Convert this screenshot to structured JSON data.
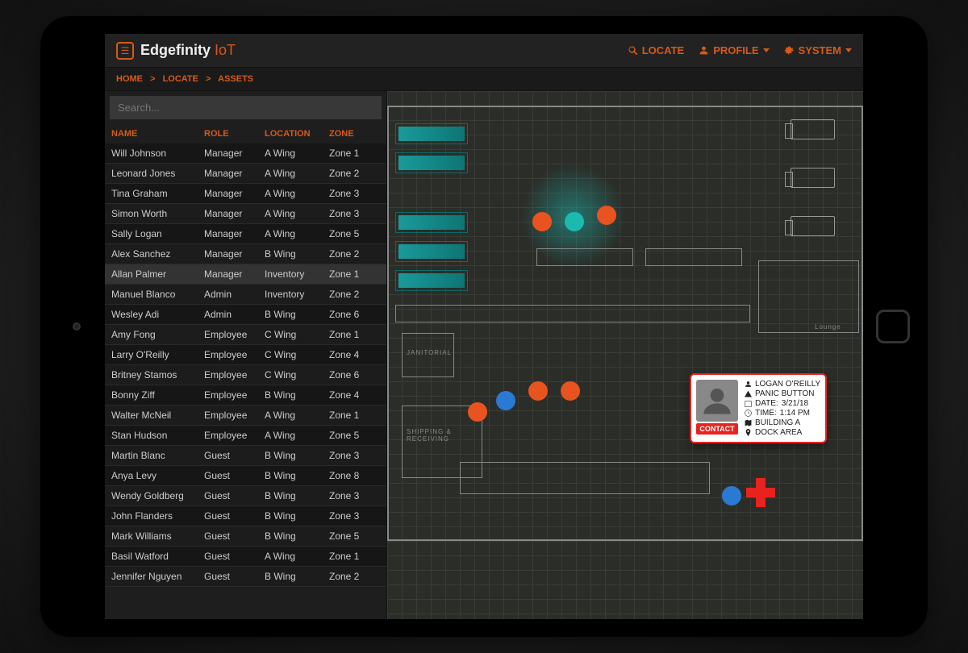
{
  "app": {
    "name": "Edgefinity",
    "suffix": "IoT"
  },
  "nav": {
    "locate": "LOCATE",
    "profile": "PROFILE",
    "system": "SYSTEM"
  },
  "breadcrumb": {
    "home": "HOME",
    "locate": "LOCATE",
    "assets": "ASSETS",
    "sep": ">"
  },
  "search": {
    "placeholder": "Search..."
  },
  "columns": {
    "name": "NAME",
    "role": "ROLE",
    "location": "LOCATION",
    "zone": "ZONE"
  },
  "people": [
    {
      "name": "Will Johnson",
      "role": "Manager",
      "location": "A Wing",
      "zone": "Zone 1"
    },
    {
      "name": "Leonard Jones",
      "role": "Manager",
      "location": "A Wing",
      "zone": "Zone 2"
    },
    {
      "name": "Tina Graham",
      "role": "Manager",
      "location": "A Wing",
      "zone": "Zone 3"
    },
    {
      "name": "Simon Worth",
      "role": "Manager",
      "location": "A Wing",
      "zone": "Zone 3"
    },
    {
      "name": "Sally Logan",
      "role": "Manager",
      "location": "A Wing",
      "zone": "Zone 5"
    },
    {
      "name": "Alex Sanchez",
      "role": "Manager",
      "location": "B Wing",
      "zone": "Zone 2"
    },
    {
      "name": "Allan Palmer",
      "role": "Manager",
      "location": "Inventory",
      "zone": "Zone 1",
      "selected": true
    },
    {
      "name": "Manuel Blanco",
      "role": "Admin",
      "location": "Inventory",
      "zone": "Zone 2"
    },
    {
      "name": "Wesley Adi",
      "role": "Admin",
      "location": "B Wing",
      "zone": "Zone 6"
    },
    {
      "name": "Amy Fong",
      "role": "Employee",
      "location": "C Wing",
      "zone": "Zone 1"
    },
    {
      "name": "Larry O'Reilly",
      "role": "Employee",
      "location": "C Wing",
      "zone": "Zone 4"
    },
    {
      "name": "Britney Stamos",
      "role": "Employee",
      "location": "C Wing",
      "zone": "Zone 6"
    },
    {
      "name": "Bonny Ziff",
      "role": "Employee",
      "location": "B Wing",
      "zone": "Zone 4"
    },
    {
      "name": "Walter McNeil",
      "role": "Employee",
      "location": "A Wing",
      "zone": "Zone 1"
    },
    {
      "name": "Stan Hudson",
      "role": "Employee",
      "location": "A Wing",
      "zone": "Zone 5"
    },
    {
      "name": "Martin Blanc",
      "role": "Guest",
      "location": "B Wing",
      "zone": "Zone 3"
    },
    {
      "name": "Anya Levy",
      "role": "Guest",
      "location": "B Wing",
      "zone": "Zone 8"
    },
    {
      "name": "Wendy Goldberg",
      "role": "Guest",
      "location": "B Wing",
      "zone": "Zone 3"
    },
    {
      "name": "John Flanders",
      "role": "Guest",
      "location": "B Wing",
      "zone": "Zone 3"
    },
    {
      "name": "Mark Williams",
      "role": "Guest",
      "location": "B Wing",
      "zone": "Zone 5"
    },
    {
      "name": "Basil Watford",
      "role": "Guest",
      "location": "A Wing",
      "zone": "Zone 1"
    },
    {
      "name": "Jennifer Nguyen",
      "role": "Guest",
      "location": "B Wing",
      "zone": "Zone 2"
    }
  ],
  "map_labels": {
    "janitorial": "JANITORIAL",
    "shipping": "SHIPPING & RECEIVING",
    "lounge": "Lounge"
  },
  "popup": {
    "name": "LOGAN O'REILLY",
    "alert": "PANIC BUTTON",
    "date_label": "DATE:",
    "date": "3/21/18",
    "time_label": "TIME:",
    "time": "1:14 PM",
    "building": "BUILDING A",
    "area": "DOCK AREA",
    "contact": "CONTACT"
  }
}
